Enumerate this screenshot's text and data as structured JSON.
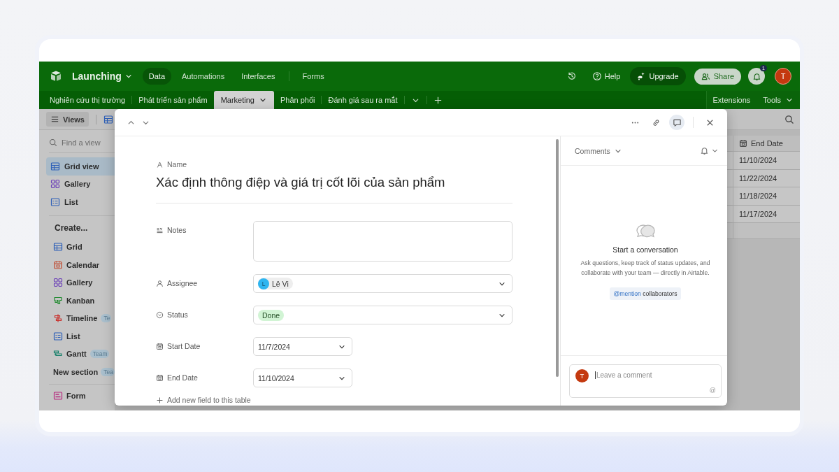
{
  "header": {
    "base_name": "Launching",
    "nav": [
      {
        "label": "Data",
        "selected": true
      },
      {
        "label": "Automations",
        "selected": false
      },
      {
        "label": "Interfaces",
        "selected": false
      },
      {
        "label": "Forms",
        "selected": false
      }
    ],
    "help": "Help",
    "upgrade": "Upgrade",
    "share": "Share",
    "notification_count": "1",
    "avatar": "T"
  },
  "tables": [
    {
      "label": "Nghiên cứu thị trường",
      "selected": false
    },
    {
      "label": "Phát triển sản phẩm",
      "selected": false
    },
    {
      "label": "Marketing",
      "selected": true
    },
    {
      "label": "Phân phối",
      "selected": false
    },
    {
      "label": "Đánh giá sau ra mắt",
      "selected": false
    }
  ],
  "table_tools": [
    "Extensions",
    "Tools"
  ],
  "views_button": "Views",
  "sidebar": {
    "search_placeholder": "Find a view",
    "views": [
      {
        "label": "Grid view",
        "selected": true
      },
      {
        "label": "Gallery",
        "selected": false
      },
      {
        "label": "List",
        "selected": false
      }
    ],
    "create_title": "Create...",
    "create": [
      {
        "label": "Grid"
      },
      {
        "label": "Calendar"
      },
      {
        "label": "Gallery"
      },
      {
        "label": "Kanban"
      },
      {
        "label": "Timeline",
        "badge": "Te"
      },
      {
        "label": "List"
      },
      {
        "label": "Gantt",
        "badge": "Team"
      }
    ],
    "section": {
      "label": "New section",
      "badge": "Tea"
    },
    "form": {
      "label": "Form"
    }
  },
  "grid": {
    "column": "End Date",
    "rows": [
      "11/10/2024",
      "11/22/2024",
      "11/18/2024",
      "11/17/2024"
    ]
  },
  "record": {
    "name_label": "Name",
    "name": "Xác định thông điệp và giá trị cốt lõi của sản phẩm",
    "fields": [
      {
        "kind": "longtext",
        "label": "Notes"
      },
      {
        "kind": "user",
        "label": "Assignee",
        "value": "Lê Vi",
        "avatar": "L"
      },
      {
        "kind": "select",
        "label": "Status",
        "value": "Done"
      },
      {
        "kind": "date",
        "label": "Start Date",
        "value": "11/7/2024"
      },
      {
        "kind": "date",
        "label": "End Date",
        "value": "11/10/2024"
      }
    ],
    "add_field": "Add new field to this table"
  },
  "comments": {
    "title": "Comments",
    "empty_title": "Start a conversation",
    "empty_text": "Ask questions, keep track of status updates, and collaborate with your team — directly in Airtable.",
    "mention": "@mention",
    "mention_rest": "collaborators",
    "avatar": "T",
    "placeholder": "Leave a comment",
    "at_sign": "@"
  }
}
